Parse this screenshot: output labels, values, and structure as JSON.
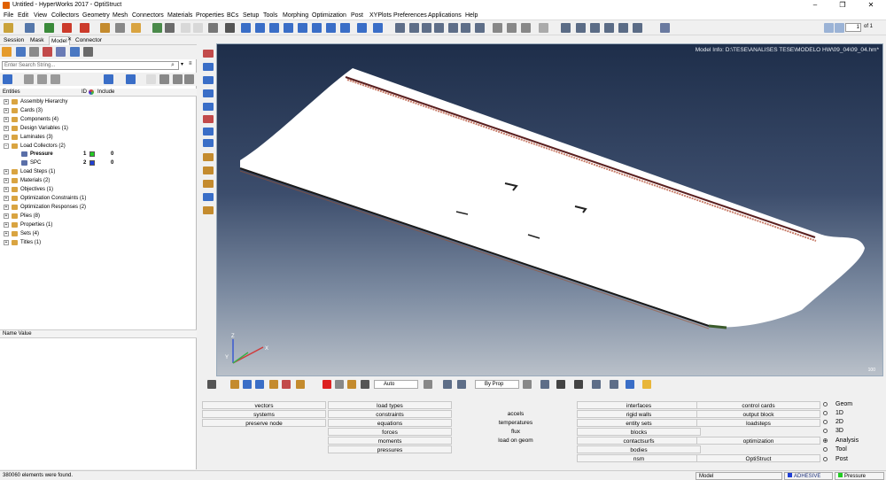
{
  "window": {
    "title": "Untitled - HyperWorks 2017 - OptiStruct",
    "minimize": "–",
    "maximize": "❐",
    "close": "✕"
  },
  "menu": [
    "File",
    "Edit",
    "View",
    "Collectors",
    "Geometry",
    "Mesh",
    "Connectors",
    "Materials",
    "Properties",
    "BCs",
    "Setup",
    "Tools",
    "Morphing",
    "Optimization",
    "Post",
    "XYPlots",
    "Preferences",
    "Applications",
    "Help"
  ],
  "pager": {
    "page": "1",
    "of": "of 1"
  },
  "panel": {
    "tabs": [
      "Session",
      "Mask",
      "Model",
      "Connector"
    ],
    "tab_close": "✕",
    "search_placeholder": "Enter Search String...",
    "search_glyph": "⌕",
    "search_opt": "▾",
    "search_opt2": "≡",
    "headers": {
      "entities": "Entities",
      "id": "ID",
      "include": "Include"
    },
    "attr_header": "Name Value"
  },
  "tree": [
    {
      "label": "Assembly Hierarchy",
      "exp": "+"
    },
    {
      "label": "Cards (3)",
      "exp": "+"
    },
    {
      "label": "Components (4)",
      "exp": "+"
    },
    {
      "label": "Design Variables (1)",
      "exp": "+"
    },
    {
      "label": "Laminates (3)",
      "exp": "+"
    },
    {
      "label": "Load Collectors (2)",
      "exp": "−"
    },
    {
      "label": "Pressure",
      "id": "1",
      "inc": "0",
      "bold": true,
      "color": "#22cc22"
    },
    {
      "label": "SPC",
      "id": "2",
      "inc": "0",
      "bold": false,
      "color": "#1f3fd6"
    },
    {
      "label": "Load Steps (1)",
      "exp": "+"
    },
    {
      "label": "Materials (2)",
      "exp": "+"
    },
    {
      "label": "Objectives (1)",
      "exp": "+"
    },
    {
      "label": "Optimization Constraints (1)",
      "exp": "+"
    },
    {
      "label": "Optimization Responses (2)",
      "exp": "+"
    },
    {
      "label": "Plies (8)",
      "exp": "+"
    },
    {
      "label": "Properties (1)",
      "exp": "+"
    },
    {
      "label": "Sets (4)",
      "exp": "+"
    },
    {
      "label": "Titles (1)",
      "exp": "+"
    }
  ],
  "viewport": {
    "model_info": "Model Info: D:\\TESE\\ANALISES TESE\\MODELO HW\\09_04\\09_04.hm*",
    "scale": "100",
    "axes": {
      "x": "X",
      "y": "Y",
      "z": "Z"
    }
  },
  "bottom_toolbar": {
    "auto": "Auto",
    "byprop": "By Prop"
  },
  "panel_menu": {
    "col1": [
      "vectors",
      "systems",
      "preserve node"
    ],
    "col2": [
      "load types",
      "constraints",
      "equations",
      "forces",
      "moments",
      "pressures"
    ],
    "col3": [
      "accels",
      "temperatures",
      "flux",
      "load on geom"
    ],
    "col4": [
      "interfaces",
      "rigid walls",
      "entity sets",
      "blocks",
      "contactsurfs",
      "bodies",
      "nsm"
    ],
    "col5": [
      "control cards",
      "output block",
      "loadsteps",
      "optimization",
      "OptiStruct"
    ]
  },
  "radios": [
    {
      "label": "Geom",
      "on": false
    },
    {
      "label": "1D",
      "on": false
    },
    {
      "label": "2D",
      "on": false
    },
    {
      "label": "3D",
      "on": false
    },
    {
      "label": "Analysis",
      "on": true
    },
    {
      "label": "Tool",
      "on": false
    },
    {
      "label": "Post",
      "on": false
    }
  ],
  "status": {
    "message": "380060 elements were found.",
    "model": "Model",
    "include": "ADHESIVE",
    "collector": "Pressure"
  }
}
